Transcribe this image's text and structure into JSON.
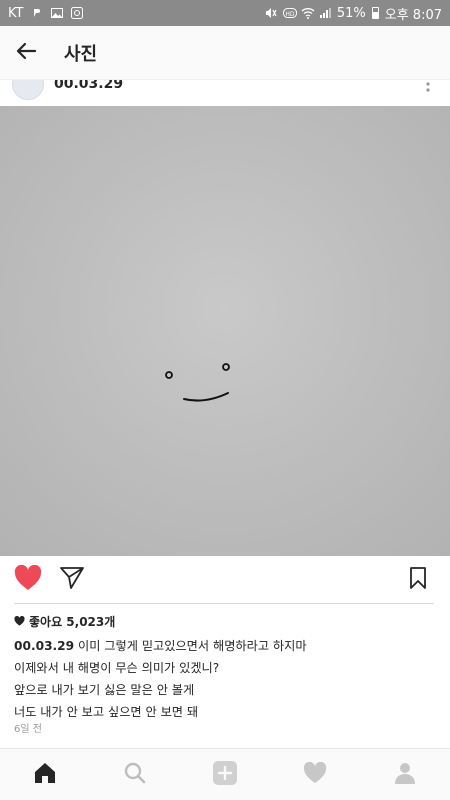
{
  "status_bar": {
    "carrier": "KT",
    "battery": "51%",
    "time": "오후 8:07",
    "icons": [
      "message-icon",
      "image-icon",
      "app-icon",
      "mute-icon",
      "hd-icon",
      "wifi-icon",
      "signal-icon",
      "battery-icon"
    ]
  },
  "header": {
    "title": "사진",
    "back_icon": "arrow-left-icon"
  },
  "post": {
    "author": "00.03.29",
    "likes_text": "좋아요 5,023개",
    "caption_username": "00.03.29",
    "caption_lines": [
      "이미 그렇게 믿고있으면서 해명하라고 하지마",
      "이제와서 내 해명이 무슨 의미가 있겠니?",
      "앞으로 내가 보기 싫은 말은 안 볼게",
      "너도 내가 안 보고 싶으면 안 보면 돼"
    ],
    "timestamp": "6일 전",
    "liked": true,
    "like_color": "#ed4956"
  },
  "bottom_nav": {
    "items": [
      "home-icon",
      "search-icon",
      "add-icon",
      "activity-icon",
      "profile-icon"
    ],
    "active": "home-icon"
  }
}
